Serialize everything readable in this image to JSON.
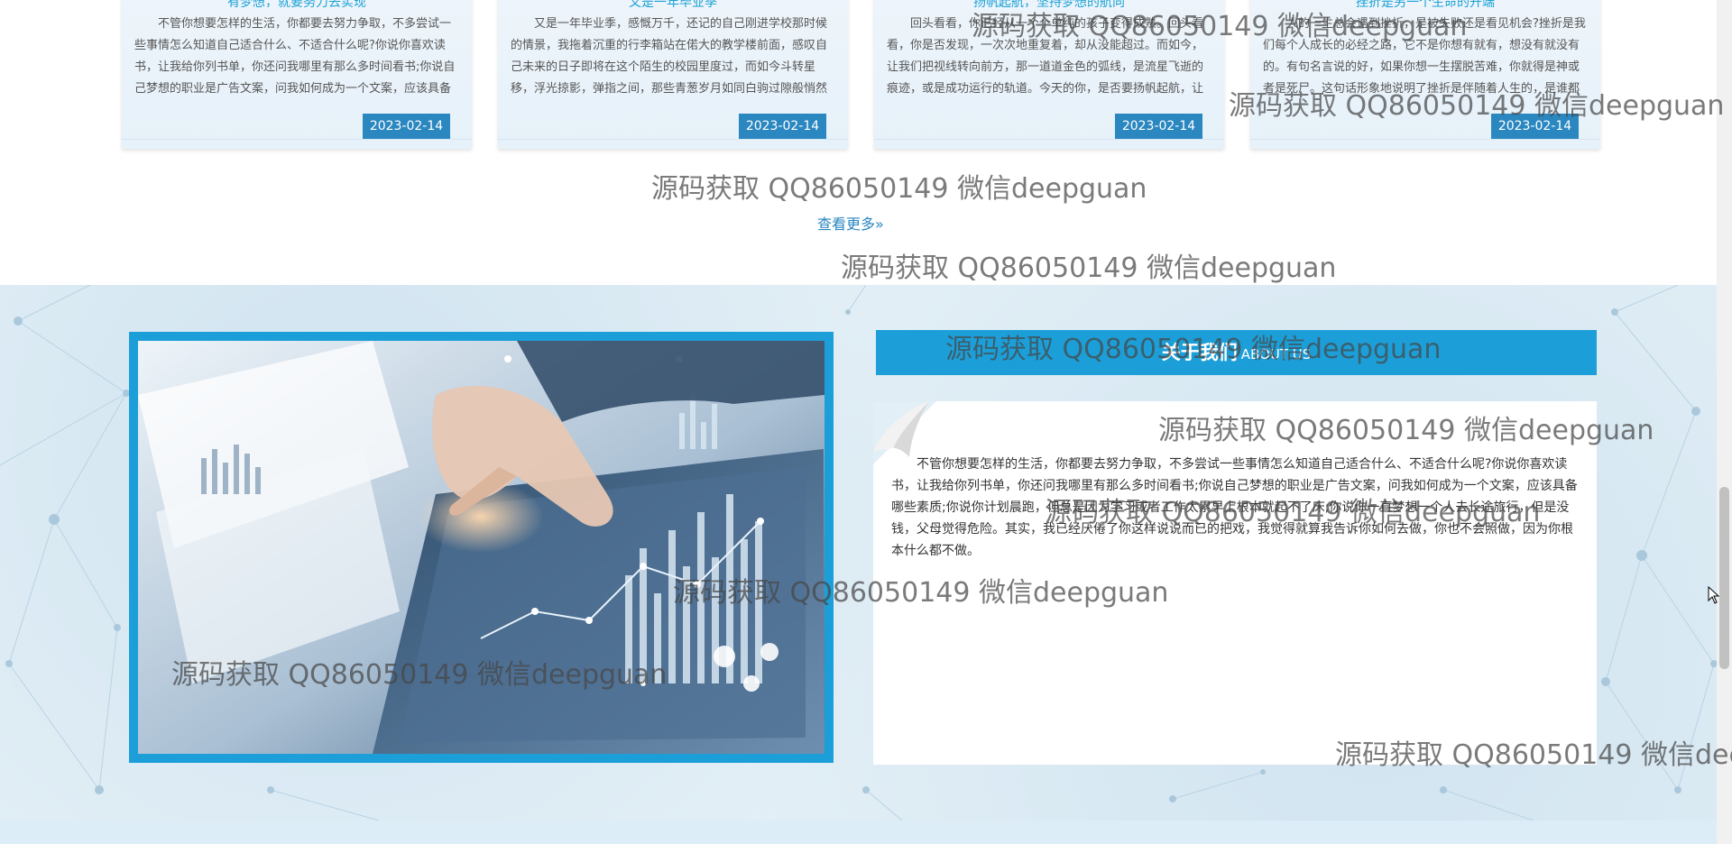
{
  "news": {
    "cards": [
      {
        "title": "有梦想，就要努力去实现",
        "text": "不管你想要怎样的生活，你都要去努力争取，不多尝试一些事情怎么知道自己适合什么、不适合什么呢?你说你喜欢读书，让我给你列书单，你还问我哪里有那么多时间看书;你说自己梦想的职业是广告文案，问我如何成为一个文案，应该具备哪些素质;你说你计划晨跑，但总是因为学",
        "date": "2023-02-14"
      },
      {
        "title": "又是一年毕业季",
        "text": "又是一年毕业季，感慨万千，还记的自己刚进学校那时候的情景，我拖着沉重的行李箱站在偌大的教学楼前面，感叹自己未来的日子即将在这个陌生的校园里度过，而如今斗转星移，浮光掠影，弹指之间，那些青葱岁月如同白驹过隙般悄然从指缝溜走。过去的种种在胸口交集纠结，像打翻的",
        "date": "2023-02-14"
      },
      {
        "title": "扬帆起航，坚持梦想的航向",
        "text": "回头看看，你已经从一个个单纯的孩子变得成熟。回头看看，你是否发现，一次次地重复着，却从没能超过。而如今，让我们把视线转向前方，那一道道金色的弧线，是流星飞逝的痕迹，或是成功运行的轨道。今天的你，是否要扬帆起航，让幸福来敲门?清晨的太阳撒向大地，神奇的宇宙",
        "date": "2023-02-14"
      },
      {
        "title": "挫折是另一个生命的开端",
        "text": "人的一生总会遇到挫折，是被失败还是看见机会?挫折是我们每个人成长的必经之路，它不是你想有就有，想没有就没有的。有句名言说的好，如果你想一生摆脱苦难，你就得是神或者是死尸。这句话形象地说明了挫折是伴随着人生的，是谁都避不掉的。",
        "date": "2023-02-14"
      }
    ],
    "more_label": "查看更多»"
  },
  "about": {
    "header_cn": "关于我们",
    "header_en": "ABOUT US",
    "text": "不管你想要怎样的生活，你都要去努力争取，不多尝试一些事情怎么知道自己适合什么、不适合什么呢?你说你喜欢读书，让我给你列书单，你还问我哪里有那么多时间看书;你说自己梦想的职业是广告文案，问我如何成为一个文案，应该具备哪些素质;你说你计划晨跑，但总是因为学习或者工作太累早上根本就起不了床;你说你一直梦想一个人去长途旅行，但是没钱，父母觉得危险。其实，我已经厌倦了你这样说说而已的把戏，我觉得就算我告诉你如何去做，你也不会照做，因为你根本什么都不做。"
  },
  "watermarks": [
    "源码获取 QQ86050149 微信deepguan",
    "源码获取 QQ86050149 微信deepguan",
    "源码获取 QQ86050149 微信deepguan",
    "源码获取 QQ86050149 微信deepguan",
    "源码获取 QQ86050149 微信deepguan",
    "源码获取 QQ86050149 微信deepguan",
    "源码获取 QQ86050149 微信deepguan",
    "源码获取 QQ86050149 微信deepguan",
    "源码获取 QQ86050149 微信deepguan",
    "源码获取 QQ86050149 微信deepguan"
  ],
  "colors": {
    "accent": "#1c9fd8",
    "date_badge": "#2a87c0",
    "link": "#2a87c0"
  }
}
